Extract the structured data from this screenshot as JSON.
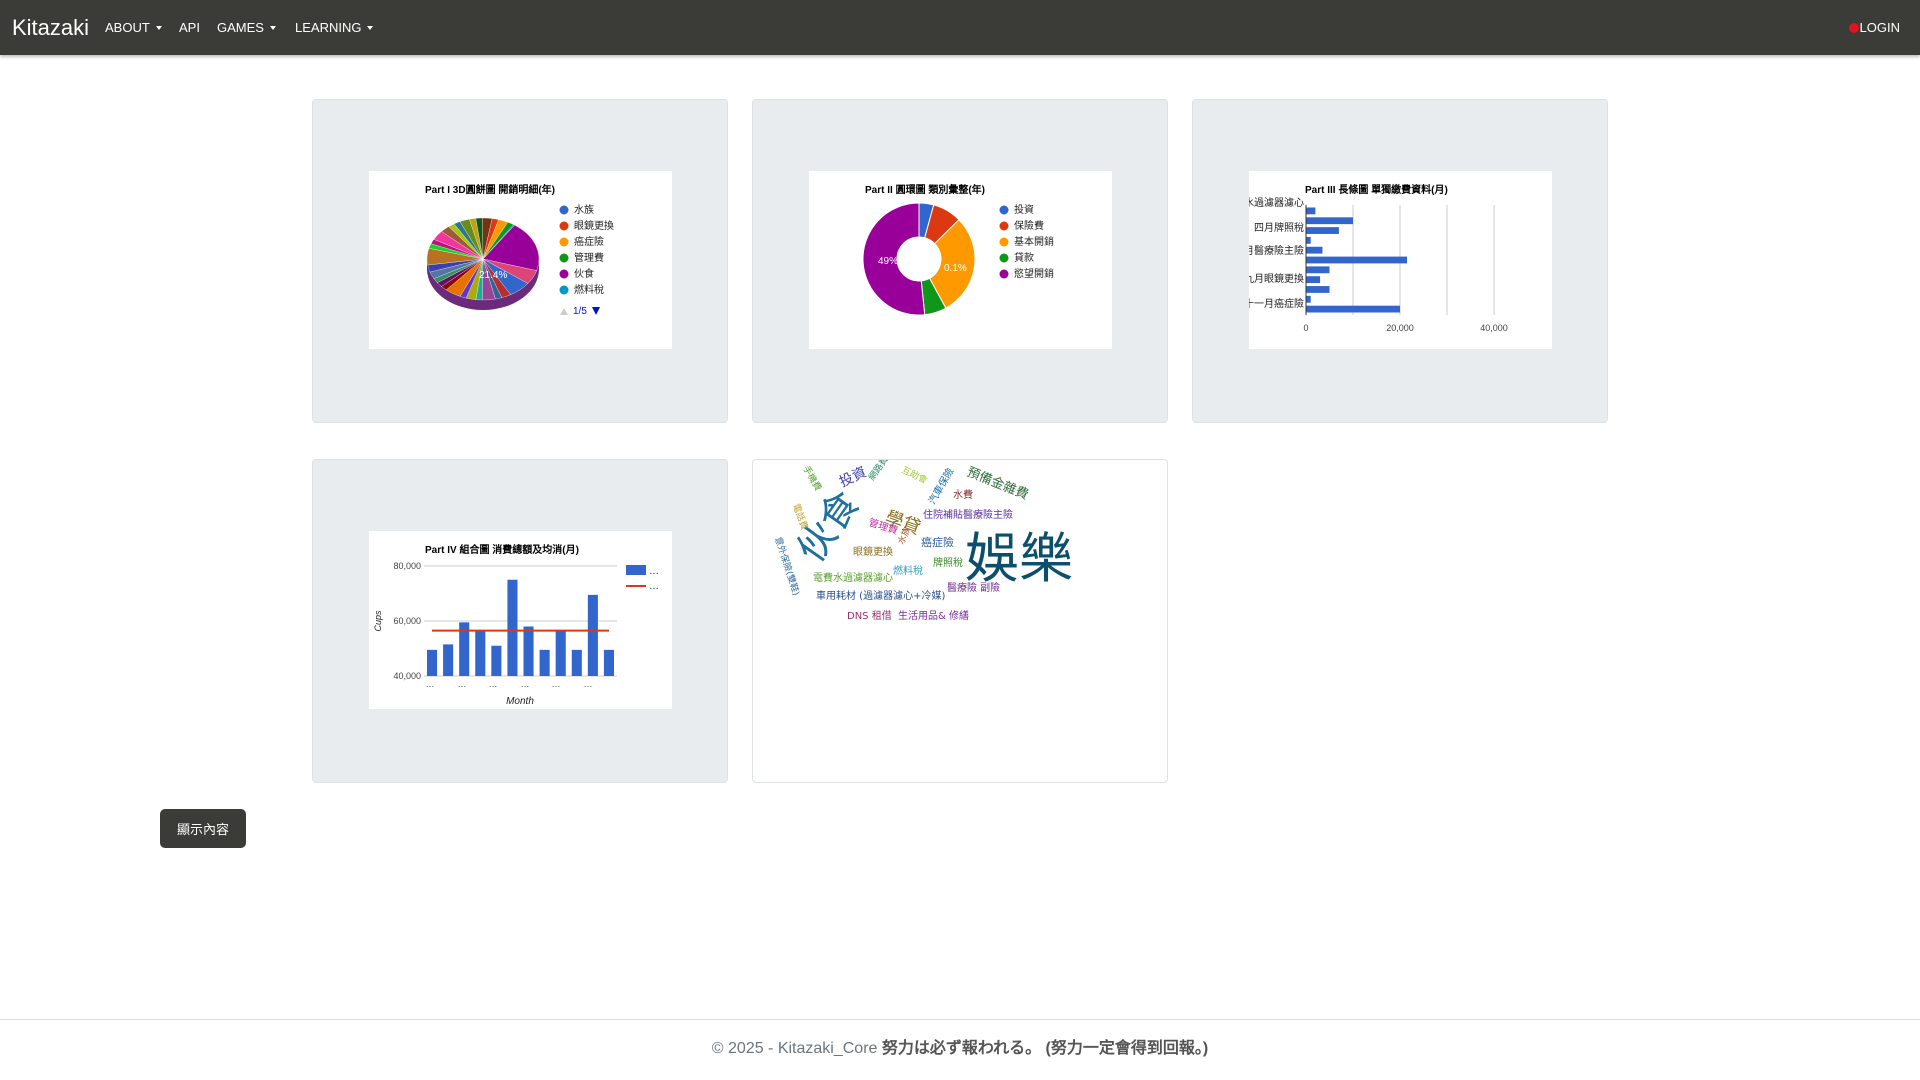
{
  "navbar": {
    "brand": "Kitazaki",
    "items": [
      {
        "label": "ABOUT",
        "dropdown": true
      },
      {
        "label": "API",
        "dropdown": false
      },
      {
        "label": "GAMES",
        "dropdown": true
      },
      {
        "label": "LEARNING",
        "dropdown": true
      }
    ],
    "login_label": "LOGIN",
    "login_status_color": "#e0141e"
  },
  "chart_data": [
    {
      "type": "pie",
      "title": "Part I 3D圓餅圖 開銷明細(年)",
      "legend": [
        "水族",
        "眼鏡更換",
        "癌症險",
        "管理費",
        "伙食",
        "燃料稅"
      ],
      "legend_page": "1/5",
      "data_labels": [
        "21.4%"
      ],
      "legend_colors": [
        "#3366cc",
        "#dc3912",
        "#ff9900",
        "#109618",
        "#990099",
        "#0099c6"
      ]
    },
    {
      "type": "pie",
      "title": "Part II 圓環圖 類別彙整(年)",
      "legend": [
        "投資",
        "保險費",
        "基本開銷",
        "貸款",
        "慾望開銷"
      ],
      "values": [
        4,
        8,
        27.9,
        6,
        49
      ],
      "data_labels": [
        "49%",
        "0.1%"
      ],
      "legend_colors": [
        "#3366cc",
        "#dc3912",
        "#ff9900",
        "#109618",
        "#990099"
      ]
    },
    {
      "type": "bar",
      "title": "Part III 長條圖 單獨繳費資料(月)",
      "orientation": "horizontal",
      "categories": [
        "二月水過濾器濾心",
        "四月牌照稅",
        "六月醫療險主險",
        "九月眼鏡更換",
        "十一月癌症險"
      ],
      "values": [
        2000,
        10000,
        7000,
        1000,
        3500,
        21500,
        5000,
        3000,
        5000,
        1000,
        20000
      ],
      "xlim": [
        0,
        40000
      ],
      "xticks": [
        "0",
        "20,000",
        "40,000"
      ]
    },
    {
      "type": "bar",
      "title": "Part IV 組合圖 消費總額及均消(月)",
      "xlabel": "Month",
      "ylabel": "Cups",
      "yticks": [
        "40,000",
        "60,000",
        "80,000"
      ],
      "ylim": [
        40000,
        80000
      ],
      "values": [
        49500,
        51500,
        59500,
        56500,
        51000,
        75000,
        58000,
        49500,
        56500,
        49500,
        69500,
        49500
      ],
      "average": 56500,
      "x_tick_labels": [
        "…",
        "…",
        "…",
        "…",
        "…",
        "…"
      ],
      "legend": [
        "…",
        "…"
      ],
      "series_colors": [
        "#3366cc",
        "#dc3912"
      ]
    }
  ],
  "wordcloud": {
    "words": [
      {
        "text": "娛樂",
        "color": "#0b4f6c"
      },
      {
        "text": "伙食",
        "color": "#1f6f9f"
      },
      {
        "text": "學貸",
        "color": "#8a6d1c"
      },
      {
        "text": "預備金雜費",
        "color": "#2f6b3a"
      },
      {
        "text": "投資",
        "color": "#3f3fb0"
      },
      {
        "text": "汽車保險",
        "color": "#1f6fa0"
      },
      {
        "text": "水費",
        "color": "#8b2d2d"
      },
      {
        "text": "住院補貼醫療險主險",
        "color": "#5b2da0"
      },
      {
        "text": "癌症險",
        "color": "#2d5fa0"
      },
      {
        "text": "牌照稅",
        "color": "#3d8b2d"
      },
      {
        "text": "燃料稅",
        "color": "#2fa0c0"
      },
      {
        "text": "眼鏡更換",
        "color": "#8b6d1c"
      },
      {
        "text": "電費水過濾器濾心",
        "color": "#5aa02d"
      },
      {
        "text": "車用耗材 (過濾器濾心+冷媒)",
        "color": "#2d4f8b"
      },
      {
        "text": "醫療險 副險",
        "color": "#6d2d8b"
      },
      {
        "text": "DNS 租借",
        "color": "#a02d6d"
      },
      {
        "text": "生活用品& 修繕",
        "color": "#7a2da0"
      },
      {
        "text": "管理費",
        "color": "#c02da0"
      },
      {
        "text": "手機費",
        "color": "#4fa02d"
      },
      {
        "text": "網路費",
        "color": "#2d8b6d"
      },
      {
        "text": "互助會",
        "color": "#9ad02d"
      },
      {
        "text": "電話費",
        "color": "#c0a02d"
      },
      {
        "text": "水族",
        "color": "#b05a2d"
      },
      {
        "text": "意外保險(雙鞋)",
        "color": "#2d6da0"
      }
    ]
  },
  "show_button_label": "顯示內容",
  "footer": {
    "prefix": "© 2025 - Kitazaki_Core",
    "motto": "努力は必ず報われる。 (努力一定會得到回報。)"
  }
}
